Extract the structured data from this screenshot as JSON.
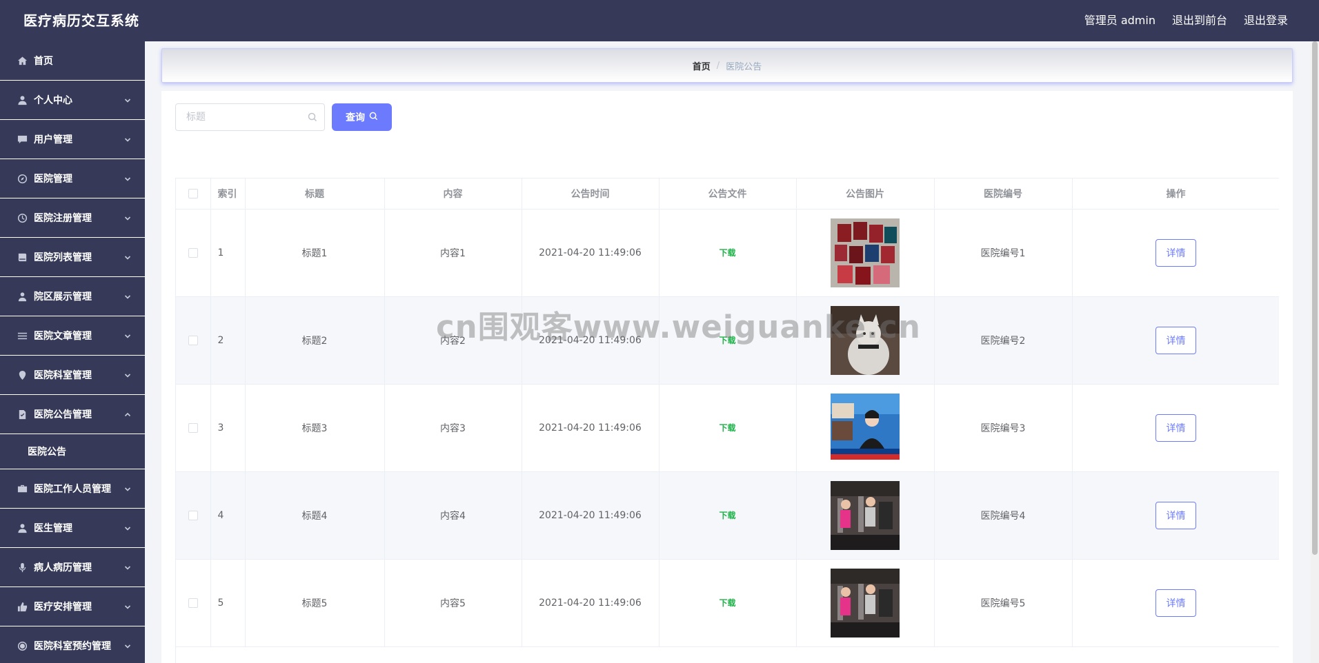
{
  "header": {
    "title": "医疗病历交互系统",
    "admin_label": "管理员 admin",
    "to_front_label": "退出到前台",
    "logout_label": "退出登录"
  },
  "sidebar": {
    "items": [
      {
        "label": "首页",
        "icon": "home-icon",
        "has_chevron": false
      },
      {
        "label": "个人中心",
        "icon": "user-icon",
        "has_chevron": true
      },
      {
        "label": "用户管理",
        "icon": "chat-icon",
        "has_chevron": true
      },
      {
        "label": "医院管理",
        "icon": "compass-icon",
        "has_chevron": true
      },
      {
        "label": "医院注册管理",
        "icon": "clock-icon",
        "has_chevron": true
      },
      {
        "label": "医院列表管理",
        "icon": "book-icon",
        "has_chevron": true
      },
      {
        "label": "院区展示管理",
        "icon": "user-badge-icon",
        "has_chevron": true
      },
      {
        "label": "医院文章管理",
        "icon": "list-icon",
        "has_chevron": true
      },
      {
        "label": "医院科室管理",
        "icon": "location-icon",
        "has_chevron": true
      },
      {
        "label": "医院公告管理",
        "icon": "document-check-icon",
        "has_chevron": true,
        "expanded": true
      },
      {
        "label": "医院工作人员管理",
        "icon": "briefcase-icon",
        "has_chevron": true
      },
      {
        "label": "医生管理",
        "icon": "user-icon",
        "has_chevron": true
      },
      {
        "label": "病人病历管理",
        "icon": "microphone-icon",
        "has_chevron": true
      },
      {
        "label": "医疗安排管理",
        "icon": "thumb-icon",
        "has_chevron": true
      },
      {
        "label": "医院科室预约管理",
        "icon": "clock-circle-icon",
        "has_chevron": true
      }
    ],
    "submenu": {
      "label": "医院公告"
    }
  },
  "breadcrumb": {
    "home": "首页",
    "separator": "/",
    "current": "医院公告"
  },
  "search": {
    "placeholder": "标题",
    "button_label": "查询"
  },
  "table": {
    "headers": {
      "index": "索引",
      "title": "标题",
      "content": "内容",
      "time": "公告时间",
      "file": "公告文件",
      "image": "公告图片",
      "hospital_no": "医院编号",
      "actions": "操作"
    },
    "rows": [
      {
        "index": "1",
        "title": "标题1",
        "content": "内容1",
        "time": "2021-04-20 11:49:06",
        "file": "下载",
        "image": "certificates-photo",
        "hospital_no": "医院编号1",
        "action": "详情"
      },
      {
        "index": "2",
        "title": "标题2",
        "content": "内容2",
        "time": "2021-04-20 11:49:06",
        "file": "下载",
        "image": "cat-photo",
        "hospital_no": "医院编号2",
        "action": "详情"
      },
      {
        "index": "3",
        "title": "标题3",
        "content": "内容3",
        "time": "2021-04-20 11:49:06",
        "file": "下载",
        "image": "news-broadcast-photo",
        "hospital_no": "医院编号3",
        "action": "详情"
      },
      {
        "index": "4",
        "title": "标题4",
        "content": "内容4",
        "time": "2021-04-20 11:49:06",
        "file": "下载",
        "image": "gym-photo",
        "hospital_no": "医院编号4",
        "action": "详情"
      },
      {
        "index": "5",
        "title": "标题5",
        "content": "内容5",
        "time": "2021-04-20 11:49:06",
        "file": "下载",
        "image": "gym-photo",
        "hospital_no": "医院编号5",
        "action": "详情"
      }
    ]
  },
  "watermark": "cn围观客www.weiguanke.cn",
  "colors": {
    "header_bg": "#363a58",
    "accent": "#6c7bfd",
    "download_green": "#20b34a",
    "stripe_bg": "#f5f7fa"
  }
}
